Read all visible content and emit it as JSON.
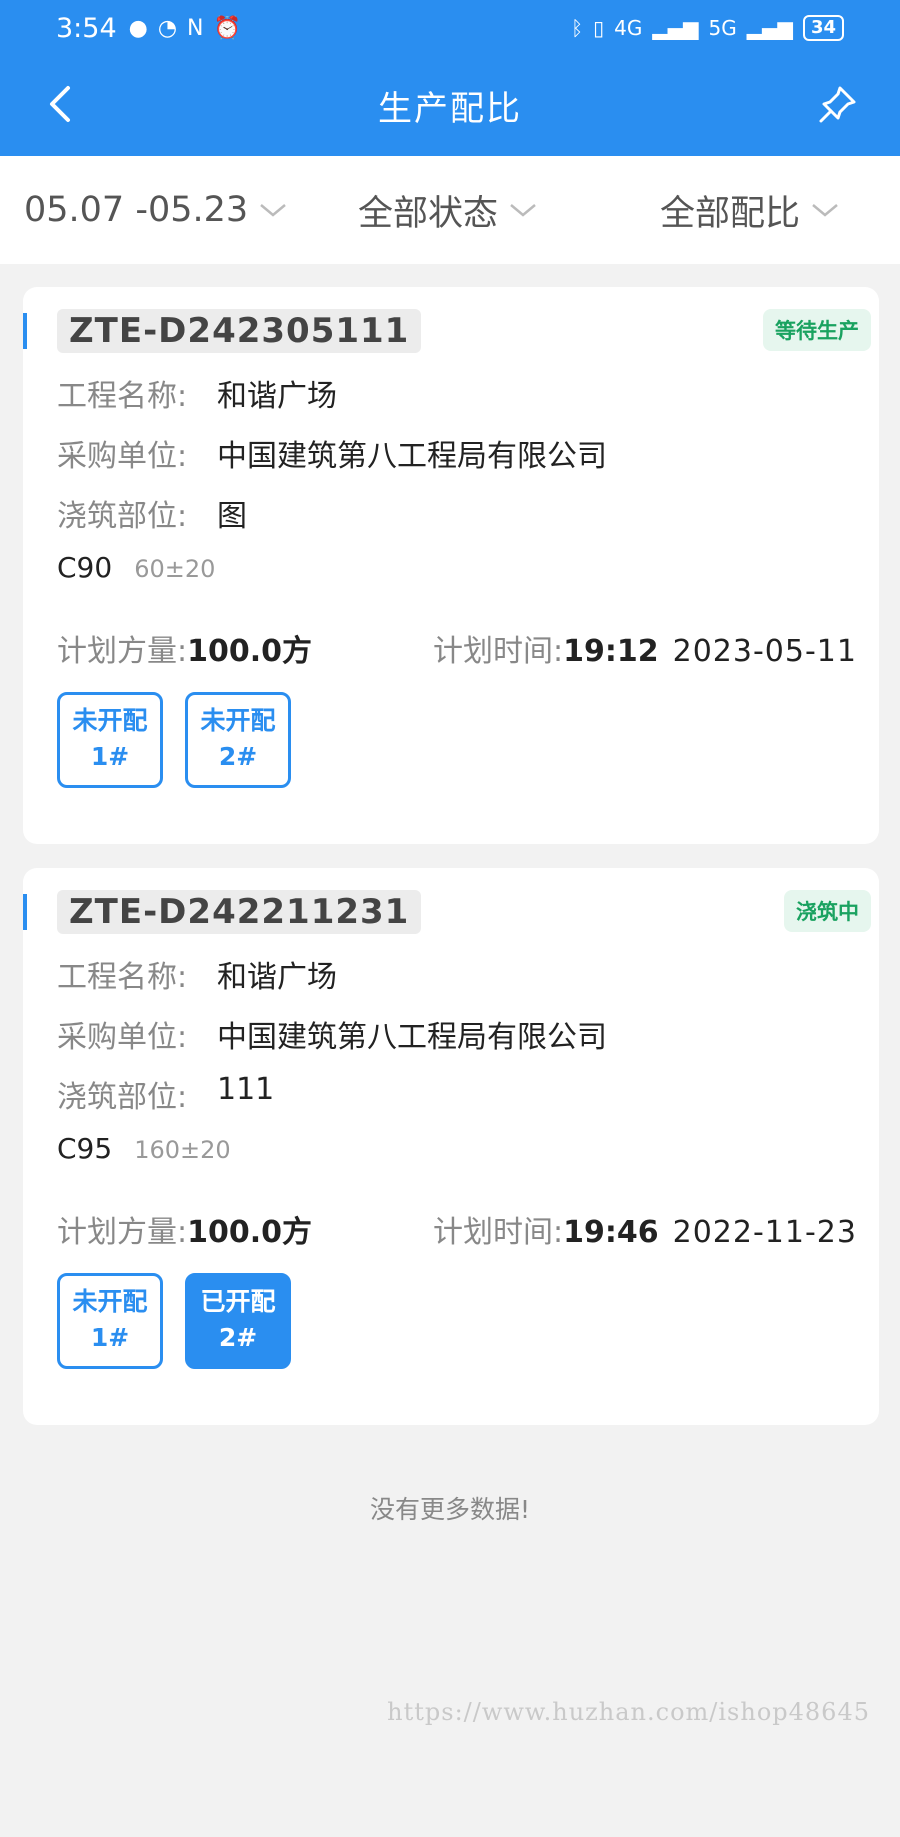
{
  "status": {
    "time": "3:54",
    "net1": "4G",
    "net2": "5G",
    "battery": "34"
  },
  "nav": {
    "title": "生产配比"
  },
  "filters": {
    "date": "05.07 -05.23",
    "status": "全部状态",
    "mix": "全部配比"
  },
  "orders": [
    {
      "code": "ZTE-D242305111",
      "badge": "等待生产",
      "project_label": "工程名称:",
      "project": "和谐广场",
      "buyer_label": "采购单位:",
      "buyer": "中国建筑第八工程局有限公司",
      "site_label": "浇筑部位:",
      "site": "图",
      "grade": "C90",
      "slump": "60±20",
      "vol_label": "计划方量:",
      "volume": "100.0方",
      "time_label": "计划时间:",
      "time": "19:12",
      "date": "2023-05-11",
      "mixes": [
        {
          "state": "未开配",
          "line": "1#"
        },
        {
          "state": "未开配",
          "line": "2#"
        }
      ]
    },
    {
      "code": "ZTE-D242211231",
      "badge": "浇筑中",
      "project_label": "工程名称:",
      "project": "和谐广场",
      "buyer_label": "采购单位:",
      "buyer": "中国建筑第八工程局有限公司",
      "site_label": "浇筑部位:",
      "site": "111",
      "grade": "C95",
      "slump": "160±20",
      "vol_label": "计划方量:",
      "volume": "100.0方",
      "time_label": "计划时间:",
      "time": "19:46",
      "date": "2022-11-23",
      "mixes": [
        {
          "state": "未开配",
          "line": "1#"
        },
        {
          "state": "已开配",
          "line": "2#"
        }
      ]
    }
  ],
  "footer": {
    "no_more": "没有更多数据!"
  },
  "watermark": "https://www.huzhan.com/ishop48645",
  "colors": {
    "primary": "#2a8ef0",
    "badge_green": "#1aa260",
    "background": "#f2f2f2"
  }
}
